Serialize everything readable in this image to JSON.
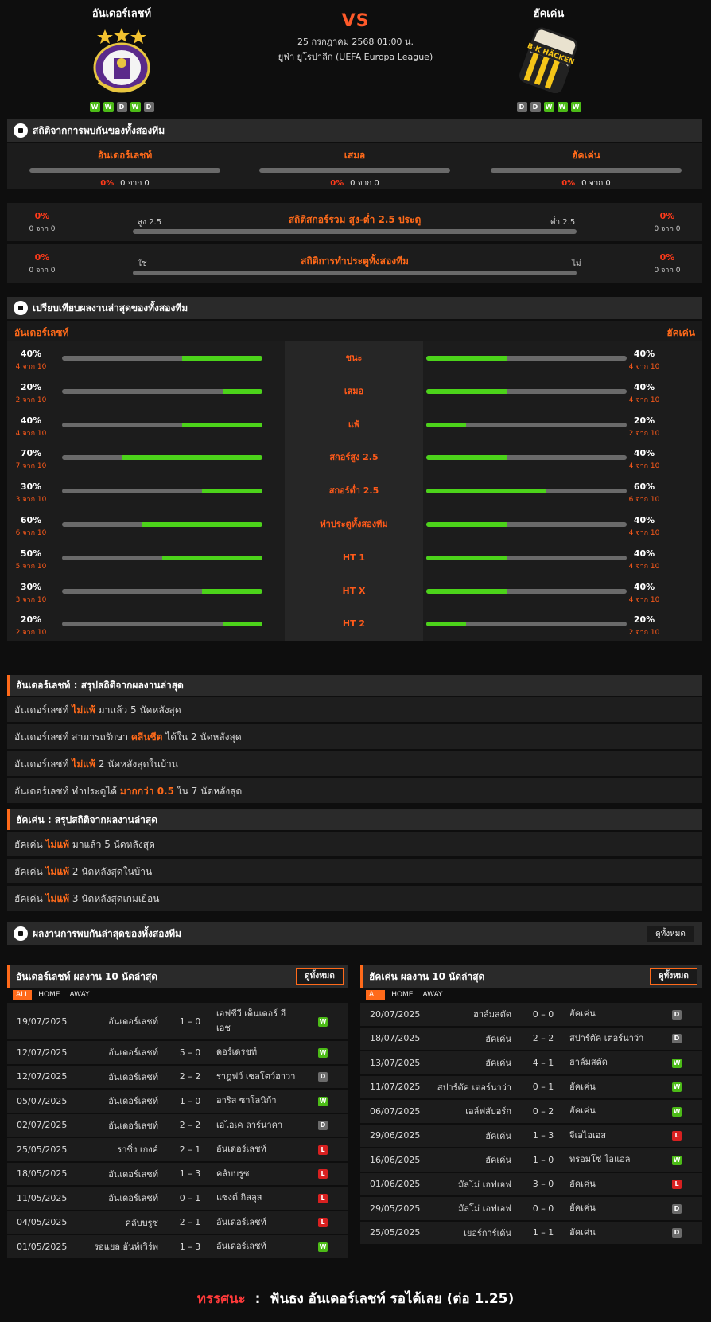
{
  "header": {
    "home_team": "อันเดอร์เลชท์",
    "away_team": "ฮัคเค่น",
    "vs": "VS",
    "date": "25 กรกฎาคม 2568 01:00 น.",
    "league": "ยูฟ่า ยูโรปาลีก (UEFA Europa League)",
    "home_form": [
      "W",
      "W",
      "D",
      "W",
      "D"
    ],
    "away_form": [
      "D",
      "D",
      "W",
      "W",
      "W"
    ],
    "away_crest_text": "B·K HÄCKEN"
  },
  "h2h": {
    "title": "สถิติจากการพบกันของทั้งสองทีม",
    "cols": [
      {
        "label": "อันเดอร์เลชท์",
        "pct": "0%",
        "count": "0 จาก 0"
      },
      {
        "label": "เสมอ",
        "pct": "0%",
        "count": "0 จาก 0"
      },
      {
        "label": "ฮัคเค่น",
        "pct": "0%",
        "count": "0 จาก 0"
      }
    ],
    "ou": {
      "title": "สถิติสกอร์รวม สูง-ต่ำ 2.5 ประตู",
      "left_label": "สูง 2.5",
      "right_label": "ต่ำ 2.5",
      "left_pct": "0%",
      "left_count": "0 จาก 0",
      "right_pct": "0%",
      "right_count": "0 จาก 0"
    },
    "btts": {
      "title": "สถิติการทำประตูทั้งสองทีม",
      "left_label": "ใช่",
      "right_label": "ไม่",
      "left_pct": "0%",
      "left_count": "0 จาก 0",
      "right_pct": "0%",
      "right_count": "0 จาก 0"
    }
  },
  "compare": {
    "title": "เปรียบเทียบผลงานล่าสุดของทั้งสองทีม",
    "home_label": "อันเดอร์เลชท์",
    "away_label": "ฮัคเค่น",
    "rows": [
      {
        "label": "ชนะ",
        "home_pct": "40%",
        "home_count": "4 จาก 10",
        "home_value": 0.4,
        "away_pct": "40%",
        "away_count": "4 จาก 10",
        "away_value": 0.4
      },
      {
        "label": "เสมอ",
        "home_pct": "20%",
        "home_count": "2 จาก 10",
        "home_value": 0.2,
        "away_pct": "40%",
        "away_count": "4 จาก 10",
        "away_value": 0.4
      },
      {
        "label": "แพ้",
        "home_pct": "40%",
        "home_count": "4 จาก 10",
        "home_value": 0.4,
        "away_pct": "20%",
        "away_count": "2 จาก 10",
        "away_value": 0.2
      },
      {
        "label": "สกอร์สูง 2.5",
        "home_pct": "70%",
        "home_count": "7 จาก 10",
        "home_value": 0.7,
        "away_pct": "40%",
        "away_count": "4 จาก 10",
        "away_value": 0.4
      },
      {
        "label": "สกอร์ต่ำ 2.5",
        "home_pct": "30%",
        "home_count": "3 จาก 10",
        "home_value": 0.3,
        "away_pct": "60%",
        "away_count": "6 จาก 10",
        "away_value": 0.6
      },
      {
        "label": "ทำประตูทั้งสองทีม",
        "home_pct": "60%",
        "home_count": "6 จาก 10",
        "home_value": 0.6,
        "away_pct": "40%",
        "away_count": "4 จาก 10",
        "away_value": 0.4
      },
      {
        "label": "HT 1",
        "home_pct": "50%",
        "home_count": "5 จาก 10",
        "home_value": 0.5,
        "away_pct": "40%",
        "away_count": "4 จาก 10",
        "away_value": 0.4
      },
      {
        "label": "HT X",
        "home_pct": "30%",
        "home_count": "3 จาก 10",
        "home_value": 0.3,
        "away_pct": "40%",
        "away_count": "4 จาก 10",
        "away_value": 0.4
      },
      {
        "label": "HT 2",
        "home_pct": "20%",
        "home_count": "2 จาก 10",
        "home_value": 0.2,
        "away_pct": "20%",
        "away_count": "2 จาก 10",
        "away_value": 0.2
      }
    ]
  },
  "summary_home": {
    "title": "อันเดอร์เลชท์ : สรุปสถิติจากผลงานล่าสุด",
    "lines": [
      {
        "pre": "อันเดอร์เลชท์",
        "hl": "ไม่แพ้",
        "post": "มาแล้ว 5 นัดหลังสุด"
      },
      {
        "pre": "อันเดอร์เลชท์ สามารถรักษา",
        "hl": "คลีนชีต",
        "post": "ได้ใน 2 นัดหลังสุด"
      },
      {
        "pre": "อันเดอร์เลชท์",
        "hl": "ไม่แพ้",
        "post": "2 นัดหลังสุดในบ้าน"
      },
      {
        "pre": "อันเดอร์เลชท์ ทำประตูได้",
        "hl": "มากกว่า 0.5",
        "post": "ใน 7 นัดหลังสุด"
      }
    ]
  },
  "summary_away": {
    "title": "ฮัคเค่น : สรุปสถิติจากผลงานล่าสุด",
    "lines": [
      {
        "pre": "ฮัคเค่น",
        "hl": "ไม่แพ้",
        "post": "มาแล้ว 5 นัดหลังสุด"
      },
      {
        "pre": "ฮัคเค่น",
        "hl": "ไม่แพ้",
        "post": "2 นัดหลังสุดในบ้าน"
      },
      {
        "pre": "ฮัคเค่น",
        "hl": "ไม่แพ้",
        "post": "3 นัดหลังสุดเกมเยือน"
      }
    ]
  },
  "h2h_results": {
    "title": "ผลงานการพบกันล่าสุดของทั้งสองทีม",
    "button": "ดูทั้งหมด"
  },
  "last_home": {
    "title": "อันเดอร์เลชท์ ผลงาน 10 นัดล่าสุด",
    "button": "ดูทั้งหมด",
    "tabs": [
      "ALL",
      "HOME",
      "AWAY"
    ],
    "matches": [
      {
        "date": "19/07/2025",
        "home": "อันเดอร์เลชท์",
        "score": "1 – 0",
        "away": "เอฟซีวี เด็นเดอร์ อีเอช",
        "res": "W"
      },
      {
        "date": "12/07/2025",
        "home": "อันเดอร์เลชท์",
        "score": "5 – 0",
        "away": "ดอร์เดรชท์",
        "res": "W"
      },
      {
        "date": "12/07/2025",
        "home": "อันเดอร์เลชท์",
        "score": "2 – 2",
        "away": "ราฎฟว์ เซลโตว์ฮาวา",
        "res": "D"
      },
      {
        "date": "05/07/2025",
        "home": "อันเดอร์เลชท์",
        "score": "1 – 0",
        "away": "อาริส ซาโลนิก้า",
        "res": "W"
      },
      {
        "date": "02/07/2025",
        "home": "อันเดอร์เลชท์",
        "score": "2 – 2",
        "away": "เอไอเค ลาร์นาคา",
        "res": "D"
      },
      {
        "date": "25/05/2025",
        "home": "ราซิ่ง เกงค์",
        "score": "2 – 1",
        "away": "อันเดอร์เลชท์",
        "res": "L"
      },
      {
        "date": "18/05/2025",
        "home": "อันเดอร์เลชท์",
        "score": "1 – 3",
        "away": "คลับบรูซ",
        "res": "L"
      },
      {
        "date": "11/05/2025",
        "home": "อันเดอร์เลชท์",
        "score": "0 – 1",
        "away": "แซงต์ กิลลุส",
        "res": "L"
      },
      {
        "date": "04/05/2025",
        "home": "คลับบรูซ",
        "score": "2 – 1",
        "away": "อันเดอร์เลชท์",
        "res": "L"
      },
      {
        "date": "01/05/2025",
        "home": "รอแยล อันท์เวิร์พ",
        "score": "1 – 3",
        "away": "อันเดอร์เลชท์",
        "res": "W"
      }
    ]
  },
  "last_away": {
    "title": "ฮัคเค่น ผลงาน 10 นัดล่าสุด",
    "button": "ดูทั้งหมด",
    "tabs": [
      "ALL",
      "HOME",
      "AWAY"
    ],
    "matches": [
      {
        "date": "20/07/2025",
        "home": "ฮาล์มสตัด",
        "score": "0 – 0",
        "away": "ฮัคเค่น",
        "res": "D"
      },
      {
        "date": "18/07/2025",
        "home": "ฮัคเค่น",
        "score": "2 – 2",
        "away": "สปาร์ตัค เตอร์นาว่า",
        "res": "D"
      },
      {
        "date": "13/07/2025",
        "home": "ฮัคเค่น",
        "score": "4 – 1",
        "away": "ฮาล์มสตัด",
        "res": "W"
      },
      {
        "date": "11/07/2025",
        "home": "สปาร์ตัค เตอร์นาว่า",
        "score": "0 – 1",
        "away": "ฮัคเค่น",
        "res": "W"
      },
      {
        "date": "06/07/2025",
        "home": "เอล์ฟสับอร์ก",
        "score": "0 – 2",
        "away": "ฮัคเค่น",
        "res": "W"
      },
      {
        "date": "29/06/2025",
        "home": "ฮัคเค่น",
        "score": "1 – 3",
        "away": "จีเอไอเอส",
        "res": "L"
      },
      {
        "date": "16/06/2025",
        "home": "ฮัคเค่น",
        "score": "1 – 0",
        "away": "ทรอมโซ่ ไอแอล",
        "res": "W"
      },
      {
        "date": "01/06/2025",
        "home": "มัลโม่ เอฟเอฟ",
        "score": "3 – 0",
        "away": "ฮัคเค่น",
        "res": "L"
      },
      {
        "date": "29/05/2025",
        "home": "มัลโม่ เอฟเอฟ",
        "score": "0 – 0",
        "away": "ฮัคเค่น",
        "res": "D"
      },
      {
        "date": "25/05/2025",
        "home": "เยอร์การ์เด้น",
        "score": "1 – 1",
        "away": "ฮัคเค่น",
        "res": "D"
      }
    ]
  },
  "verdict": {
    "label": "ทรรศนะ",
    "colon": ":",
    "text": "ฟันธง อันเดอร์เลชท์ รอได้เลย (ต่อ 1.25)"
  },
  "colors": {
    "accent": "#ff6a1a",
    "win": "#4cbb17",
    "draw": "#6b6b6b",
    "loss": "#d82020",
    "bar_fill": "#4cd31a",
    "bar_track": "#6a6a6a"
  }
}
